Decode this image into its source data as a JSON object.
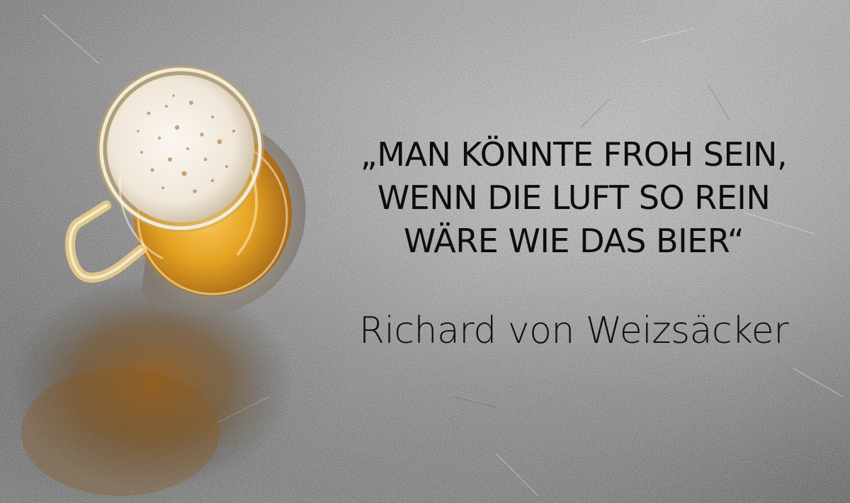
{
  "quote": {
    "lines": [
      "„MAN KÖNNTE FROH SEIN,",
      "WENN DIE LUFT SO REIN",
      "WÄRE WIE DAS BIER“"
    ]
  },
  "author": "Richard von Weizsäcker",
  "colors": {
    "background": "#a0a0a0",
    "text": "#0d0d0d",
    "beer": "#e8a21c",
    "foam": "#f3ede4"
  },
  "image": {
    "subject": "beer-mug-icon"
  }
}
